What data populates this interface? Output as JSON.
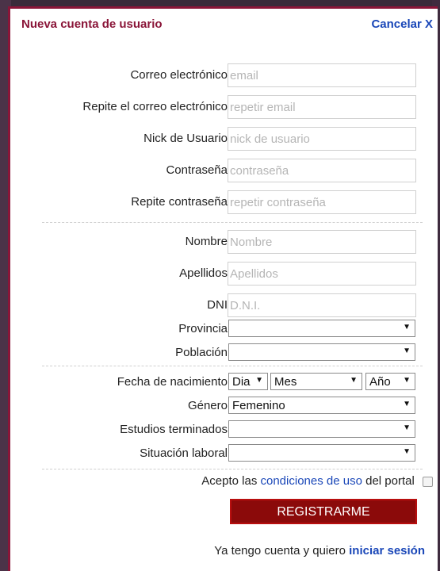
{
  "header": {
    "title": "Nueva cuenta de usuario",
    "cancel": "Cancelar X"
  },
  "account": {
    "email_label": "Correo electrónico",
    "email_ph": "email",
    "email2_label": "Repite el correo electrónico",
    "email2_ph": "repetir email",
    "nick_label": "Nick de Usuario",
    "nick_ph": "nick de usuario",
    "pass_label": "Contraseña",
    "pass_ph": "contraseña",
    "pass2_label": "Repite contraseña",
    "pass2_ph": "repetir contraseña"
  },
  "personal": {
    "name_label": "Nombre",
    "name_ph": "Nombre",
    "surname_label": "Apellidos",
    "surname_ph": "Apellidos",
    "dni_label": "DNI",
    "dni_ph": "D.N.I.",
    "province_label": "Provincia",
    "province_value": "",
    "town_label": "Población",
    "town_value": ""
  },
  "details": {
    "birth_label": "Fecha de nacimiento",
    "day": "Dia",
    "month": "Mes",
    "year": "Año",
    "gender_label": "Género",
    "gender_value": "Femenino",
    "studies_label": "Estudios terminados",
    "studies_value": "",
    "work_label": "Situación laboral",
    "work_value": ""
  },
  "terms": {
    "prefix": "Acepto las",
    "link": "condiciones de uso",
    "suffix": "del portal",
    "checked": false
  },
  "register_button": "REGISTRARME",
  "footer": {
    "text": "Ya tengo cuenta y quiero",
    "link": "iniciar sesión"
  },
  "colors": {
    "brand": "#8a1538",
    "link": "#1a47b8",
    "button": "#8b0a0a"
  }
}
